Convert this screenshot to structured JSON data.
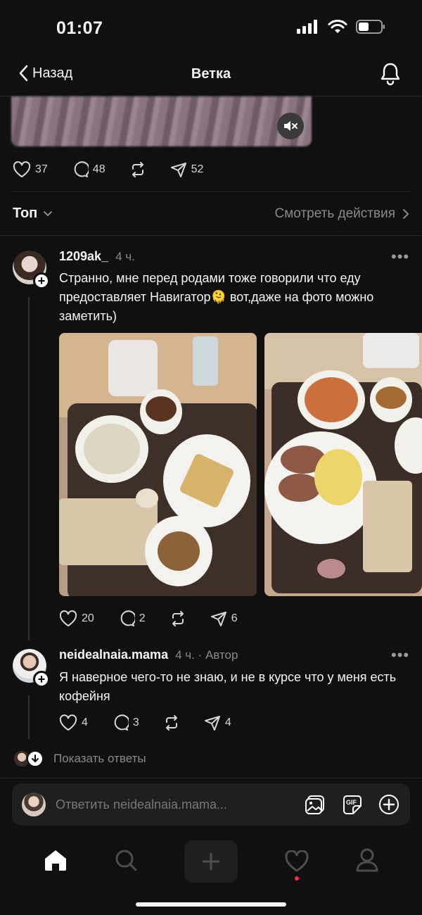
{
  "status_bar": {
    "time": "01:07"
  },
  "header": {
    "back_label": "Назад",
    "title": "Ветка"
  },
  "top_post": {
    "stats": {
      "likes": "37",
      "comments": "48",
      "reposts": "",
      "shares": "52"
    }
  },
  "sort": {
    "label": "Топ",
    "activity_link": "Смотреть действия"
  },
  "comments": [
    {
      "username": "1209ak_",
      "time": "4 ч.",
      "text": "Странно, мне перед родами тоже говорили что еду предоставляет Навигатор🫠 вот,даже на фото можно заметить)",
      "stats": {
        "likes": "20",
        "comments": "2",
        "shares": "6"
      }
    },
    {
      "username": "neidealnaia.mama",
      "time": "4 ч. · Автор",
      "text": "Я наверное чего-то не знаю, и не в курсе что у меня есть кофейня",
      "stats": {
        "likes": "4",
        "comments": "3",
        "shares": "4"
      }
    }
  ],
  "show_replies": "Показать ответы",
  "reply_bar": {
    "placeholder": "Ответить neidealnaia.mama..."
  },
  "icons": {
    "back": "chevron-left-icon",
    "bell": "bell-icon",
    "like": "heart-icon",
    "comment": "comment-bubble-icon",
    "repost": "repost-icon",
    "share": "paper-plane-icon",
    "gallery": "image-icon",
    "gif": "gif-icon",
    "add": "plus-circle-icon"
  },
  "colors": {
    "background": "#101010",
    "text": "#f3f5f7",
    "muted": "#8a8a8a",
    "notification": "#ff3040"
  }
}
